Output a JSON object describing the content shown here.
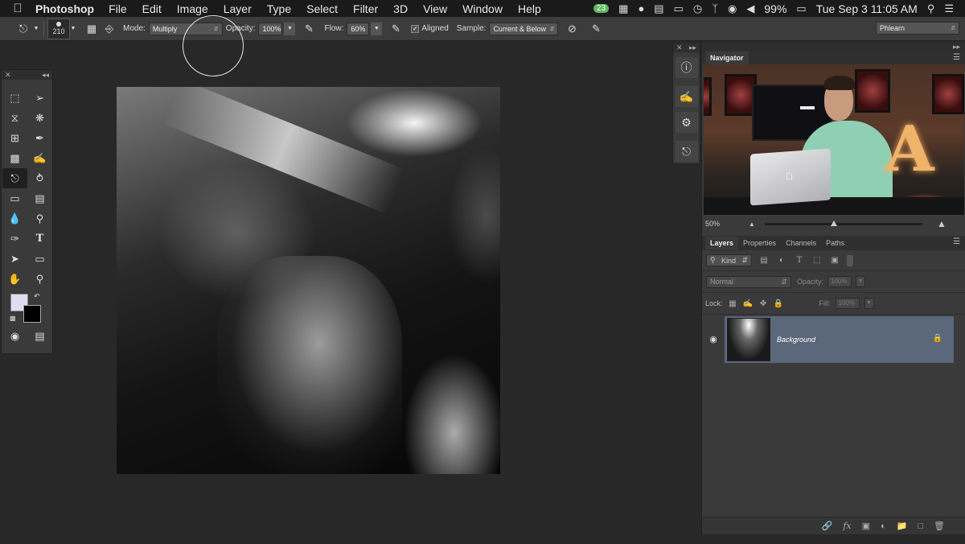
{
  "menubar": {
    "app": "Photoshop",
    "menus": [
      "File",
      "Edit",
      "Image",
      "Layer",
      "Type",
      "Select",
      "Filter",
      "3D",
      "View",
      "Window",
      "Help"
    ],
    "badge": "23",
    "battery": "99%",
    "clock": "Tue Sep 3  11:05 AM"
  },
  "options": {
    "brush_size": "210",
    "mode_label": "Mode:",
    "mode_value": "Multiply",
    "opacity_label": "Opacity:",
    "opacity_value": "100%",
    "flow_label": "Flow:",
    "flow_value": "60%",
    "aligned_label": "Aligned",
    "sample_label": "Sample:",
    "sample_value": "Current & Below",
    "workspace": "Phlearn"
  },
  "navigator": {
    "title": "Navigator",
    "zoom": "50%",
    "preview_letter": "A"
  },
  "layers": {
    "tabs": [
      "Layers",
      "Properties",
      "Channels",
      "Paths"
    ],
    "filter_kind": "Kind",
    "blend_mode": "Normal",
    "opacity_label": "Opacity:",
    "opacity_value": "100%",
    "lock_label": "Lock:",
    "fill_label": "Fill:",
    "fill_value": "100%",
    "layer_name": "Background"
  },
  "colors": {
    "foreground": "#e0dcf0",
    "background": "#000000",
    "layer_selected": "#5b677b"
  }
}
